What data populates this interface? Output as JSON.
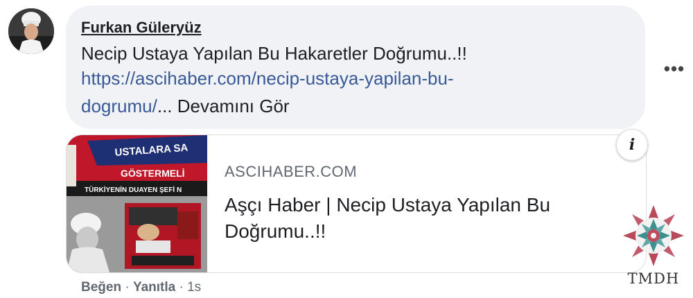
{
  "comment": {
    "author": "Furkan Güleryüz",
    "text_line1": "Necip Ustaya Yapılan Bu Hakaretler Doğrumu..!!",
    "link_part1": "https://ascihaber.com/necip-ustaya-yapilan-bu-",
    "link_part2": "dogrumu/",
    "ellipsis": "...",
    "see_more": "Devamını Gör"
  },
  "more_options": {
    "label": "•••",
    "icon": "more-horizontal-icon"
  },
  "link_preview": {
    "domain": "ASCIHABER.COM",
    "title": "Aşçı Haber | Necip Ustaya Yapılan Bu Doğrumu..!!",
    "thumbnail": {
      "banner_text": "USTALARA SA",
      "subbanner_text": "GÖSTERMELİ",
      "strip_text": "TÜRKİYENİN DUAYEN ŞEFİ N"
    },
    "info_icon": "info-icon",
    "info_label": "i"
  },
  "actions": {
    "like": "Beğen",
    "sep1": " · ",
    "reply": "Yanıtla",
    "sep2": " · ",
    "time": "1s"
  },
  "watermark": {
    "text": "TMDH"
  },
  "colors": {
    "bubble_bg": "#f0f2f5",
    "link": "#385898",
    "meta": "#606770",
    "thumb_red": "#c0182a",
    "thumb_navy": "#1f2f73"
  }
}
